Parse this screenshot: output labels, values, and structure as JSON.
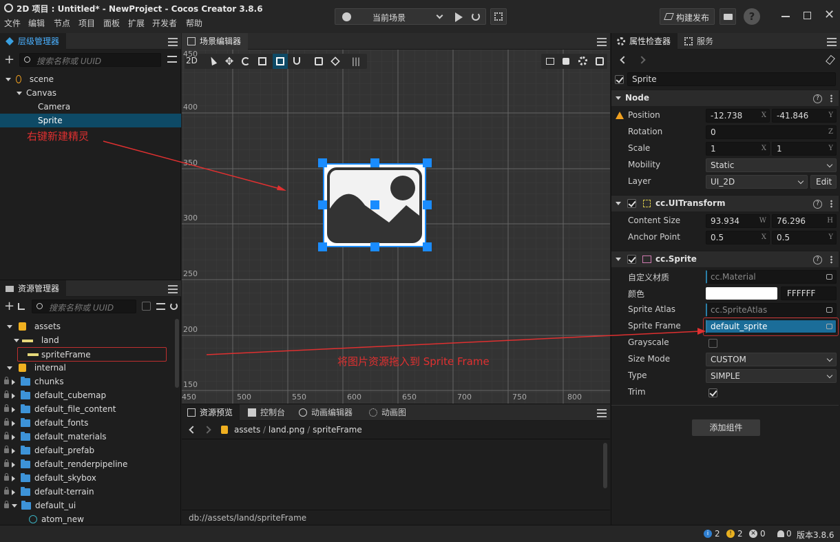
{
  "window": {
    "title": "2D 项目 : Untitled* - NewProject - Cocos Creator 3.8.6",
    "scene_select": "当前场景",
    "build_button": "构建发布"
  },
  "menu": [
    "文件",
    "编辑",
    "节点",
    "项目",
    "面板",
    "扩展",
    "开发者",
    "帮助"
  ],
  "hierarchy": {
    "tab": "层级管理器",
    "search_placeholder": "搜索名称或 UUID",
    "nodes": [
      "scene",
      "Canvas",
      "Camera",
      "Sprite"
    ],
    "annotation": "右键新建精灵"
  },
  "scene_editor": {
    "tab": "场景编辑器",
    "mode": "2D",
    "y_labels": [
      "400",
      "350",
      "300",
      "250",
      "200",
      "150"
    ],
    "y_label_top": "450",
    "x_labels": [
      "450",
      "500",
      "550",
      "600",
      "650",
      "700",
      "750",
      "800"
    ],
    "annotation": "将图片资源拖入到 Sprite Frame"
  },
  "assets": {
    "tab": "资源管理器",
    "search_placeholder": "搜索名称或 UUID",
    "items": [
      {
        "label": "assets",
        "icon": "db"
      },
      {
        "label": "land",
        "icon": "image"
      },
      {
        "label": "spriteFrame",
        "icon": "image"
      },
      {
        "label": "internal",
        "icon": "db"
      },
      {
        "label": "chunks",
        "icon": "folder"
      },
      {
        "label": "default_cubemap",
        "icon": "folder"
      },
      {
        "label": "default_file_content",
        "icon": "folder"
      },
      {
        "label": "default_fonts",
        "icon": "folder"
      },
      {
        "label": "default_materials",
        "icon": "folder"
      },
      {
        "label": "default_prefab",
        "icon": "folder"
      },
      {
        "label": "default_renderpipeline",
        "icon": "folder"
      },
      {
        "label": "default_skybox",
        "icon": "folder"
      },
      {
        "label": "default-terrain",
        "icon": "folder"
      },
      {
        "label": "default_ui",
        "icon": "folder"
      },
      {
        "label": "atom_new",
        "icon": "atom"
      }
    ]
  },
  "bottom": {
    "tabs": [
      "资源预览",
      "控制台",
      "动画编辑器",
      "动画图"
    ],
    "path": [
      "assets",
      "land.png",
      "spriteFrame"
    ],
    "footer": "db://assets/land/spriteFrame"
  },
  "inspector": {
    "tabs": [
      "属性检查器",
      "服务"
    ],
    "node_name": "Sprite",
    "node_section": "Node",
    "position": {
      "label": "Position",
      "x": "-12.738",
      "y": "-41.846"
    },
    "rotation": {
      "label": "Rotation",
      "z": "0"
    },
    "scale": {
      "label": "Scale",
      "x": "1",
      "y": "1"
    },
    "mobility": {
      "label": "Mobility",
      "value": "Static"
    },
    "layer": {
      "label": "Layer",
      "value": "UI_2D",
      "edit": "Edit"
    },
    "uitransform": "cc.UITransform",
    "content_size": {
      "label": "Content Size",
      "w": "93.934",
      "h": "76.296"
    },
    "anchor": {
      "label": "Anchor Point",
      "x": "0.5",
      "y": "0.5"
    },
    "sprite": "cc.Sprite",
    "custom_material": {
      "label": "自定义材质",
      "value": "cc.Material"
    },
    "color": {
      "label": "颜色",
      "value": "FFFFFF",
      "swatch": "#ffffff"
    },
    "sprite_atlas": {
      "label": "Sprite Atlas",
      "value": "cc.SpriteAtlas"
    },
    "sprite_frame": {
      "label": "Sprite Frame",
      "value": "default_sprite"
    },
    "grayscale": {
      "label": "Grayscale",
      "checked": false
    },
    "size_mode": {
      "label": "Size Mode",
      "value": "CUSTOM"
    },
    "type": {
      "label": "Type",
      "value": "SIMPLE"
    },
    "trim": {
      "label": "Trim",
      "checked": true
    },
    "add_component": "添加组件",
    "axis": {
      "x": "X",
      "y": "Y",
      "z": "Z",
      "w": "W",
      "h": "H"
    }
  },
  "status": {
    "info": "2",
    "warn": "2",
    "error": "0",
    "bell": "0",
    "version": "版本3.8.6"
  },
  "colors": {
    "accent": "#1a8cff",
    "selected": "#0e4a66",
    "annotation": "#e03030"
  }
}
